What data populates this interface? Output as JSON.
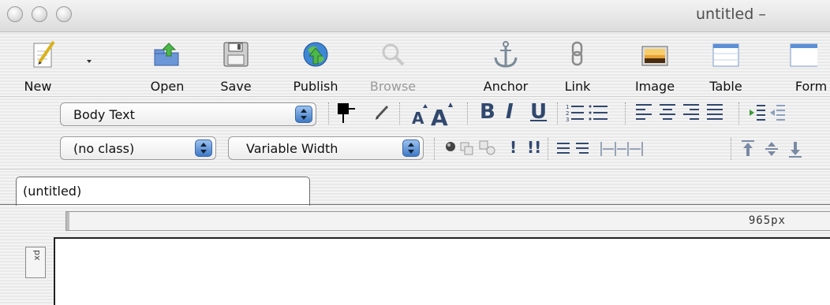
{
  "window": {
    "title": "untitled –"
  },
  "toolbar": {
    "new": "New",
    "open": "Open",
    "save": "Save",
    "publish": "Publish",
    "browse": "Browse",
    "anchor": "Anchor",
    "link": "Link",
    "image": "Image",
    "table": "Table",
    "form": "Form"
  },
  "format": {
    "paragraph_style": "Body Text",
    "class": "(no class)",
    "font": "Variable Width"
  },
  "tabs": [
    {
      "label": "(untitled)"
    }
  ],
  "ruler": {
    "width_label": "965px",
    "vertical_label": "xd"
  },
  "colors": {
    "accent": "#3f79c6",
    "text_color": "#000000"
  }
}
